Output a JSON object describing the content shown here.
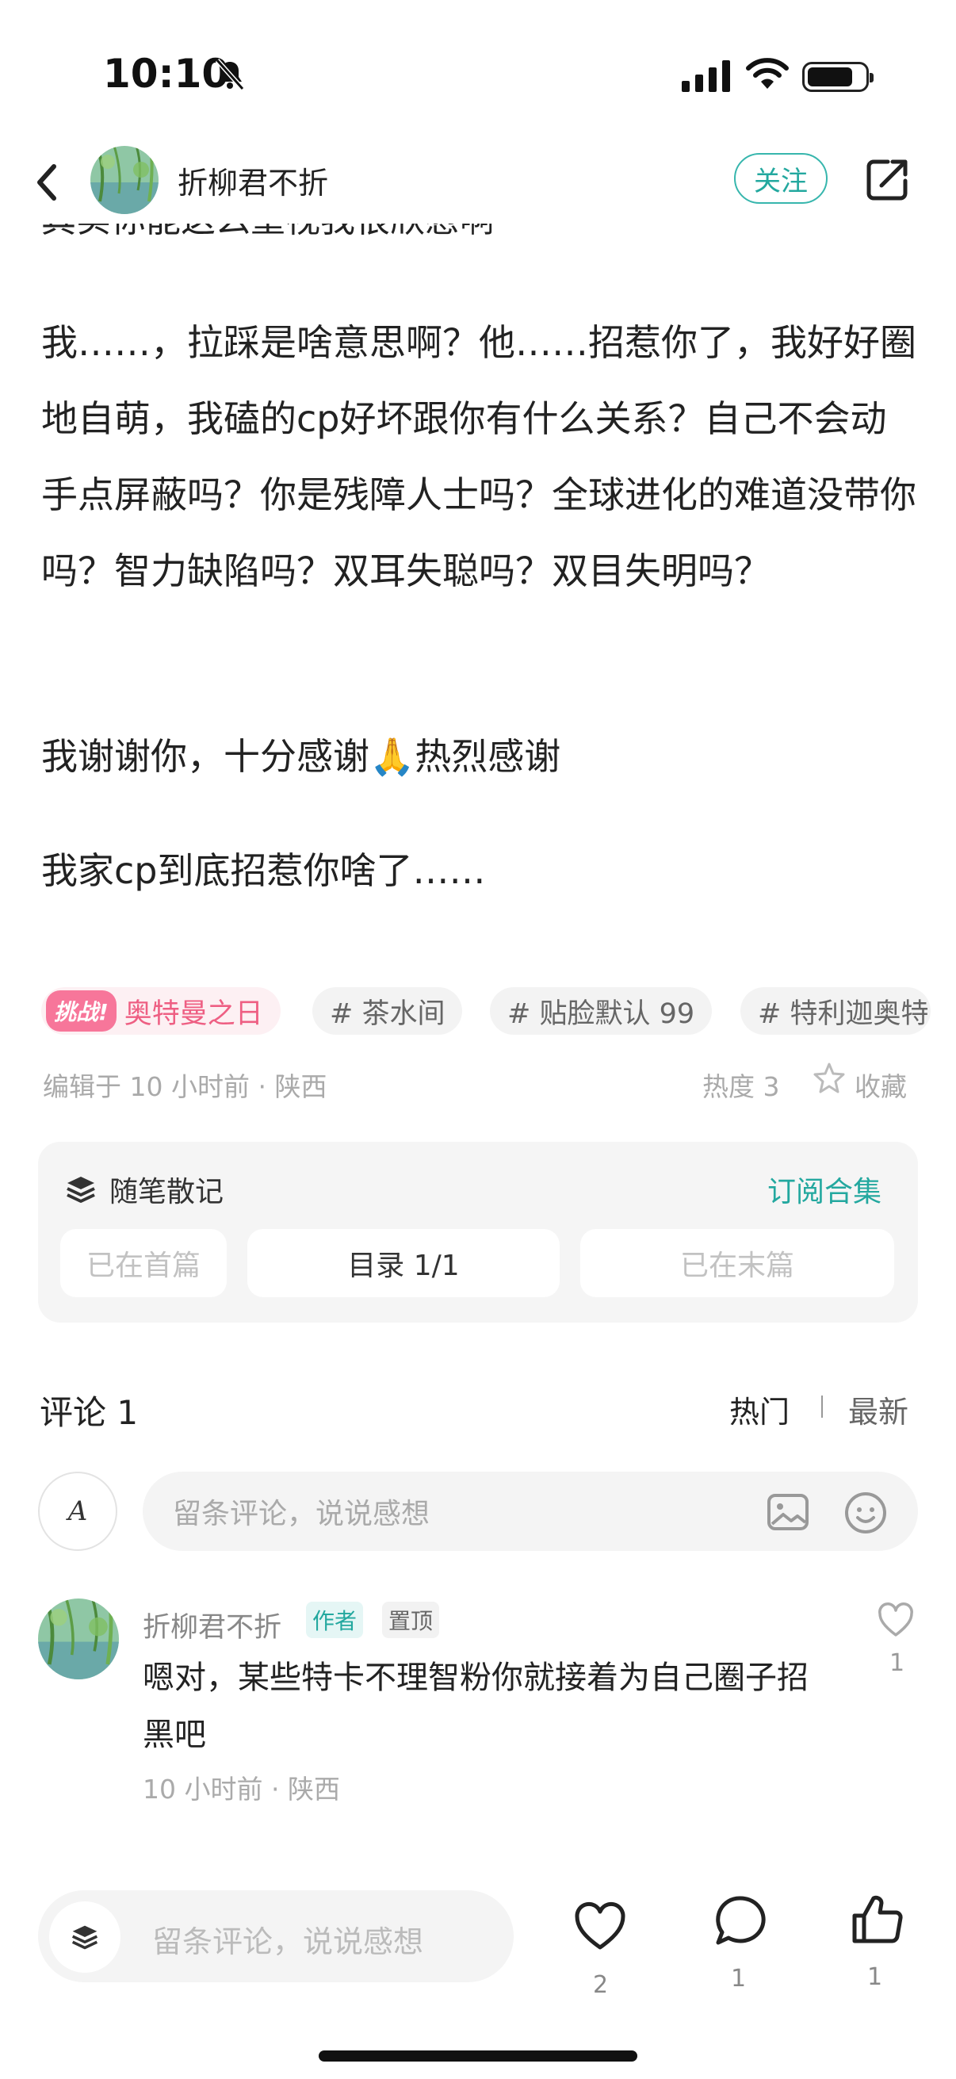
{
  "status_bar": {
    "time": "10:10"
  },
  "header": {
    "author_name": "折柳君不折",
    "follow_label": "关注"
  },
  "post": {
    "cut_off_line": "其实你能这么重视我很欣慰啊",
    "paragraph_1": "我……，拉踩是啥意思啊？他……招惹你了，我好好圈地自萌，我磕的cp好坏跟你有什么关系？自己不会动手点屏蔽吗？你是残障人士吗？全球进化的难道没带你吗？智力缺陷吗？双耳失聪吗？双目失明吗？",
    "paragraph_2": "我谢谢你，十分感谢🙏热烈感谢",
    "paragraph_3": "我家cp到底招惹你啥了……"
  },
  "tags": {
    "challenge_badge": "挑战!",
    "challenge_name": "奥特曼之日",
    "items": [
      "# 茶水间",
      "# 贴脸默认 99",
      "# 特利迦奥特"
    ]
  },
  "meta": {
    "edited": "编辑于 10 小时前 · 陕西",
    "heat": "热度 3",
    "favorite": "收藏"
  },
  "collection": {
    "title": "随笔散记",
    "subscribe": "订阅合集",
    "prev": "已在首篇",
    "toc": "目录 1/1",
    "next": "已在末篇"
  },
  "comments": {
    "title": "评论 1",
    "sort_hot": "热门",
    "sort_new": "最新",
    "input_placeholder": "留条评论，说说感想",
    "my_avatar_letter": "A",
    "items": [
      {
        "name": "折柳君不折",
        "badge_author": "作者",
        "badge_pinned": "置顶",
        "text": "嗯对，某些特卡不理智粉你就接着为自己圈子招黑吧",
        "meta": "10 小时前 · 陕西",
        "likes": "1"
      }
    ]
  },
  "bottom_bar": {
    "placeholder": "留条评论，说说感想",
    "like_count": "2",
    "comment_count": "1",
    "thumb_count": "1"
  },
  "colors": {
    "accent": "#23a89f",
    "challenge_pink": "#ee5f83"
  }
}
